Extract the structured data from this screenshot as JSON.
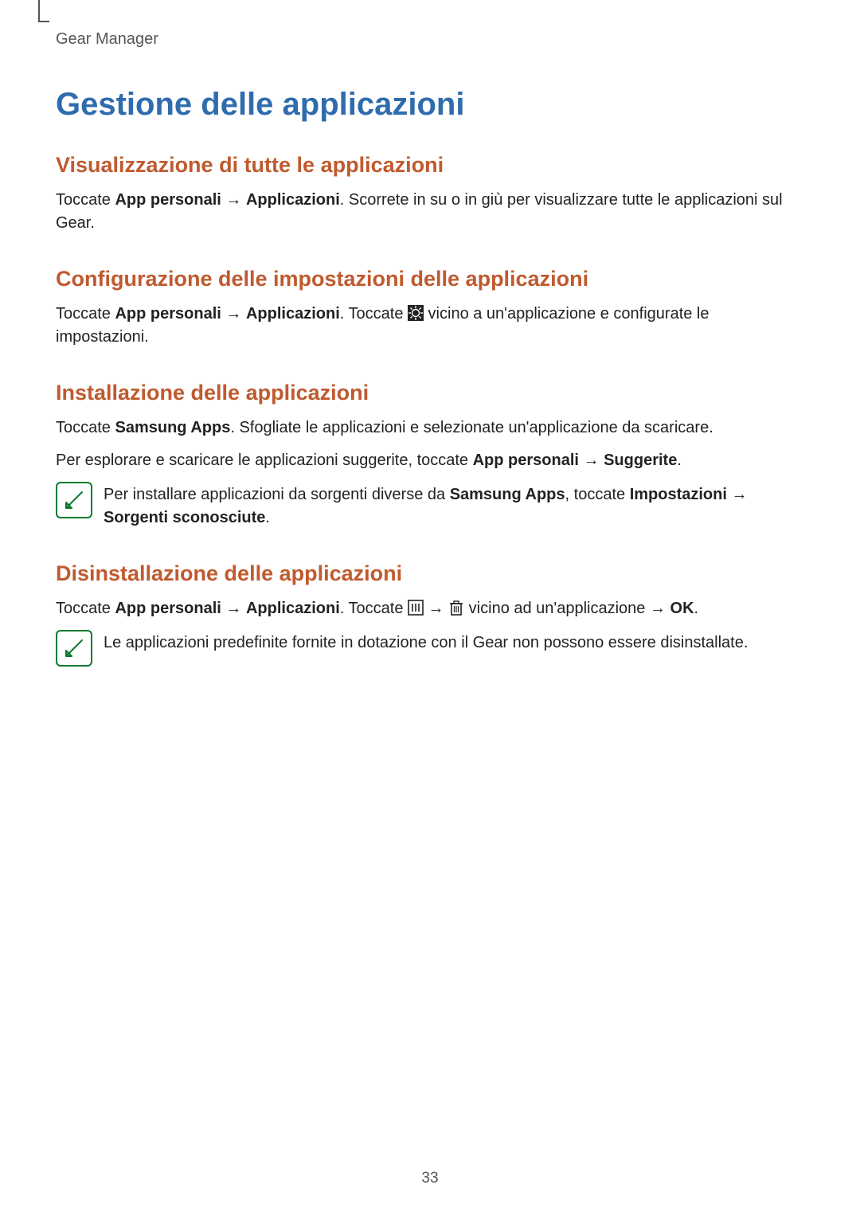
{
  "header": {
    "section": "Gear Manager"
  },
  "title": "Gestione delle applicazioni",
  "sections": {
    "view": {
      "heading": "Visualizzazione di tutte le applicazioni",
      "p1_pre": "Toccate ",
      "p1_b1": "App personali",
      "p1_arrow": " → ",
      "p1_b2": "Applicazioni",
      "p1_post": ". Scorrete in su o in giù per visualizzare tutte le applicazioni sul Gear."
    },
    "config": {
      "heading": "Configurazione delle impostazioni delle applicazioni",
      "p1_pre": "Toccate ",
      "p1_b1": "App personali",
      "p1_arrow": " → ",
      "p1_b2": "Applicazioni",
      "p1_mid": ". Toccate ",
      "p1_post": " vicino a un'applicazione e configurate le impostazioni."
    },
    "install": {
      "heading": "Installazione delle applicazioni",
      "p1_pre": "Toccate ",
      "p1_b1": "Samsung Apps",
      "p1_post": ". Sfogliate le applicazioni e selezionate un'applicazione da scaricare.",
      "p2_pre": "Per esplorare e scaricare le applicazioni suggerite, toccate ",
      "p2_b1": "App personali",
      "p2_arrow": " → ",
      "p2_b2": "Suggerite",
      "p2_post": ".",
      "note_pre": "Per installare applicazioni da sorgenti diverse da ",
      "note_b1": "Samsung Apps",
      "note_mid": ", toccate ",
      "note_b2": "Impostazioni",
      "note_arrow": " → ",
      "note_b3": "Sorgenti sconosciute",
      "note_post": "."
    },
    "uninstall": {
      "heading": "Disinstallazione delle applicazioni",
      "p1_pre": "Toccate ",
      "p1_b1": "App personali",
      "p1_arrow1": " → ",
      "p1_b2": "Applicazioni",
      "p1_mid1": ". Toccate ",
      "p1_arrow2": " → ",
      "p1_mid2": " vicino ad un'applicazione → ",
      "p1_b3": "OK",
      "p1_post": ".",
      "note": "Le applicazioni predefinite fornite in dotazione con il Gear non possono essere disinstallate."
    }
  },
  "page_number": "33"
}
